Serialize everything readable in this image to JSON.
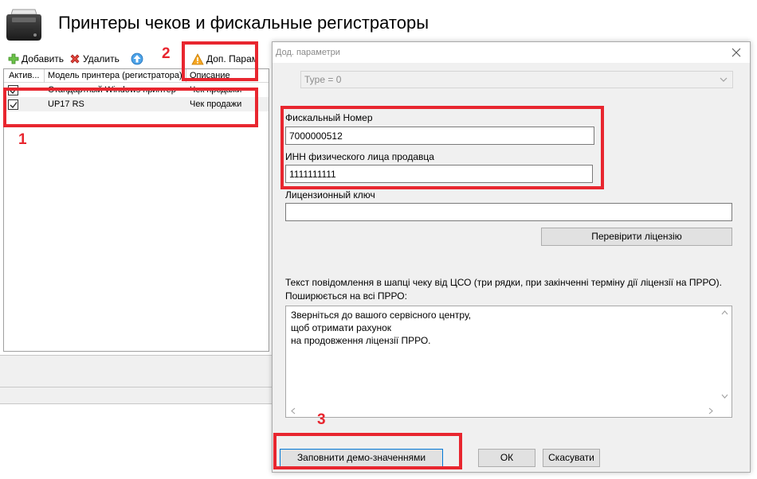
{
  "main": {
    "title": "Принтеры чеков и фискальные регистраторы",
    "toolbar": {
      "add_label": "Добавить",
      "delete_label": "Удалить",
      "extra_params_label": "Доп. Парам"
    },
    "grid": {
      "columns": [
        "Актив...",
        "Модель принтера (регистратора)",
        "Описание"
      ],
      "rows": [
        {
          "active": true,
          "model": "Стандартный Windows принтер",
          "description": "Чек продажи"
        },
        {
          "active": true,
          "model": "UP17 RS",
          "description": "Чек продажи"
        }
      ]
    }
  },
  "dialog": {
    "title": "Дод. параметри",
    "type_value": "Type = 0",
    "fiscal_number_label": "Фискальный Номер",
    "fiscal_number_value": "7000000512",
    "inn_label": "ИНН физического лица продавца",
    "inn_value": "1111111111",
    "license_key_label": "Лицензионный ключ",
    "license_key_value": "",
    "check_license_label": "Перевірити ліцензію",
    "message_description": "Текст повідомлення в шапці чеку від ЦСО (три рядки, при закінченні терміну дії ліцензії на ПРРО). Поширюється на всі ПРРО:",
    "message_lines": [
      "Зверніться до вашого сервісного центру,",
      "щоб отримати рахунок",
      "на продовження ліцензії ПРРО."
    ],
    "fill_demo_label": "Заповнити демо-значеннями",
    "ok_label": "ОК",
    "cancel_label": "Скасувати"
  },
  "annotations": {
    "labels": [
      "1",
      "2",
      "3"
    ],
    "color": "#e8262f"
  }
}
